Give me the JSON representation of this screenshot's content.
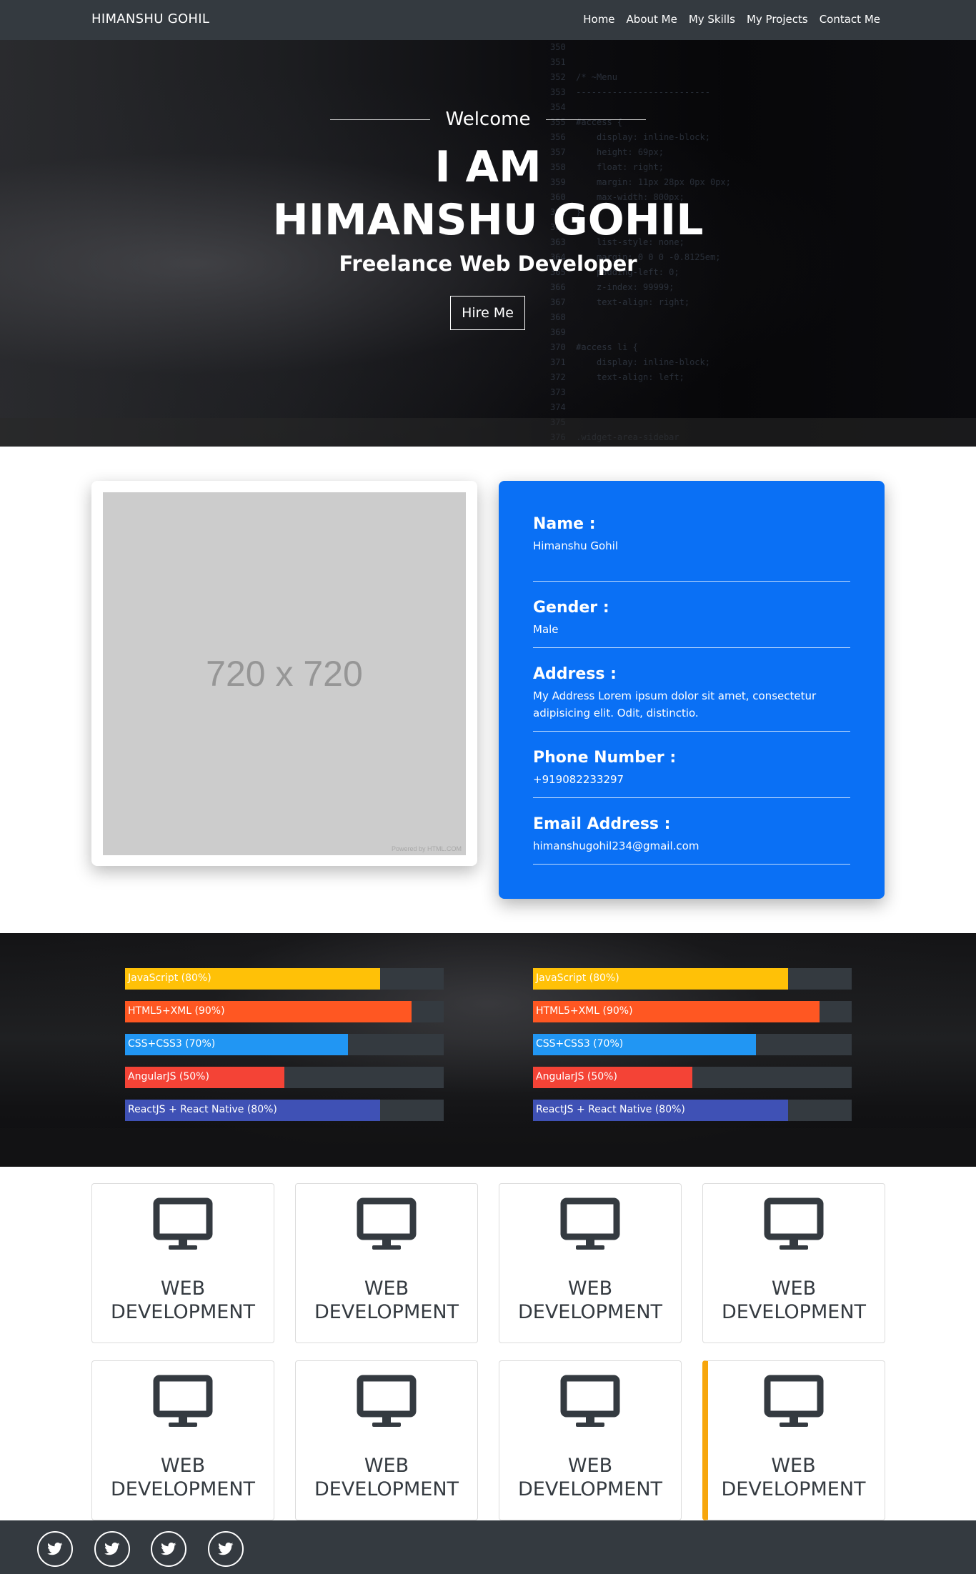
{
  "navbar": {
    "brand": "HIMANSHU GOHIL",
    "links": [
      "Home",
      "About Me",
      "My Skills",
      "My Projects",
      "Contact Me"
    ]
  },
  "hero": {
    "welcome": "Welcome",
    "line1": "I AM",
    "line2": "HIMANSHU GOHIL",
    "subtitle": "Freelance Web Developer",
    "cta": "Hire Me"
  },
  "about": {
    "photo_placeholder": "720 x 720",
    "photo_watermark": "Powered by HTML.COM",
    "fields": [
      {
        "label": "Name :",
        "value": "Himanshu Gohil"
      },
      {
        "label": "Gender :",
        "value": "Male"
      },
      {
        "label": "Address :",
        "value": "My Address Lorem ipsum dolor sit amet, consectetur adipisicing elit. Odit, distinctio."
      },
      {
        "label": "Phone Number :",
        "value": "+919082233297"
      },
      {
        "label": "Email Address :",
        "value": "himanshugohil234@gmail.com"
      }
    ]
  },
  "skills": {
    "columns": [
      [
        {
          "label": "JavaScript (80%)",
          "percent": 80,
          "color": "#ffc107"
        },
        {
          "label": "HTML5+XML (90%)",
          "percent": 90,
          "color": "#ff5722"
        },
        {
          "label": "CSS+CSS3 (70%)",
          "percent": 70,
          "color": "#2196f3"
        },
        {
          "label": "AngularJS (50%)",
          "percent": 50,
          "color": "#f44336"
        },
        {
          "label": "ReactJS + React Native (80%)",
          "percent": 80,
          "color": "#3f51b5"
        }
      ],
      [
        {
          "label": "JavaScript (80%)",
          "percent": 80,
          "color": "#ffc107"
        },
        {
          "label": "HTML5+XML (90%)",
          "percent": 90,
          "color": "#ff5722"
        },
        {
          "label": "CSS+CSS3 (70%)",
          "percent": 70,
          "color": "#2196f3"
        },
        {
          "label": "AngularJS (50%)",
          "percent": 50,
          "color": "#f44336"
        },
        {
          "label": "ReactJS + React Native (80%)",
          "percent": 80,
          "color": "#3f51b5"
        }
      ]
    ]
  },
  "services": [
    {
      "line1": "WEB",
      "line2": "DEVELOPMENT",
      "icon": "monitor-icon"
    },
    {
      "line1": "WEB",
      "line2": "DEVELOPMENT",
      "icon": "monitor-icon"
    },
    {
      "line1": "WEB",
      "line2": "DEVELOPMENT",
      "icon": "monitor-icon"
    },
    {
      "line1": "WEB",
      "line2": "DEVELOPMENT",
      "icon": "monitor-icon"
    },
    {
      "line1": "WEB",
      "line2": "DEVELOPMENT",
      "icon": "monitor-icon"
    },
    {
      "line1": "WEB",
      "line2": "DEVELOPMENT",
      "icon": "monitor-icon"
    },
    {
      "line1": "WEB",
      "line2": "DEVELOPMENT",
      "icon": "monitor-icon"
    },
    {
      "line1": "WEB",
      "line2": "DEVELOPMENT",
      "icon": "monitor-icon",
      "highlight": true
    }
  ],
  "footer": {
    "social": [
      "twitter-icon",
      "twitter-icon",
      "twitter-icon",
      "twitter-icon"
    ]
  },
  "colors": {
    "navbar": "#343a40",
    "info_card": "#0a70f5",
    "highlight_border": "#f7a60c"
  }
}
